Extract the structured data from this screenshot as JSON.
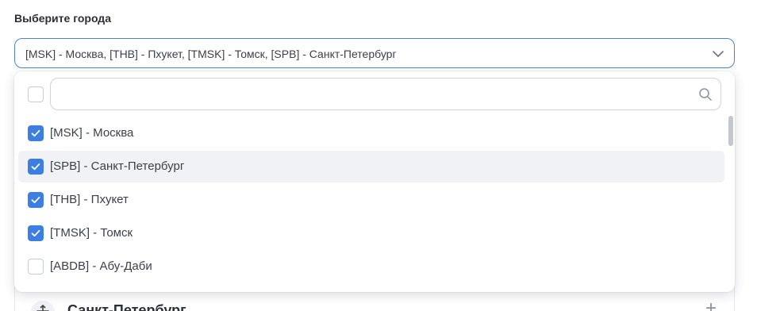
{
  "field": {
    "label": "Выберите города",
    "value": "[MSK] - Москва, [THB] - Пхукет, [TMSK] - Томск, [SPB] - Санкт-Петербург"
  },
  "dropdown": {
    "select_all_checked": false,
    "search": {
      "placeholder": "",
      "value": ""
    },
    "options": [
      {
        "label": "[MSK] - Москва",
        "checked": true
      },
      {
        "label": "[SPB] - Санкт-Петербург",
        "checked": true
      },
      {
        "label": "[THB] - Пхукет",
        "checked": true
      },
      {
        "label": "[TMSK] - Томск",
        "checked": true
      },
      {
        "label": "[ABDB] - Абу-Даби",
        "checked": false
      }
    ]
  },
  "card": {
    "title": "Санкт-Петербург"
  },
  "colors": {
    "accent": "#3c7fe0",
    "border_focus": "#4b84c9",
    "highlight": "#f1f2f5"
  },
  "icons": [
    "chevron-down-icon",
    "search-icon",
    "check-icon",
    "move-icon",
    "plus-icon"
  ]
}
